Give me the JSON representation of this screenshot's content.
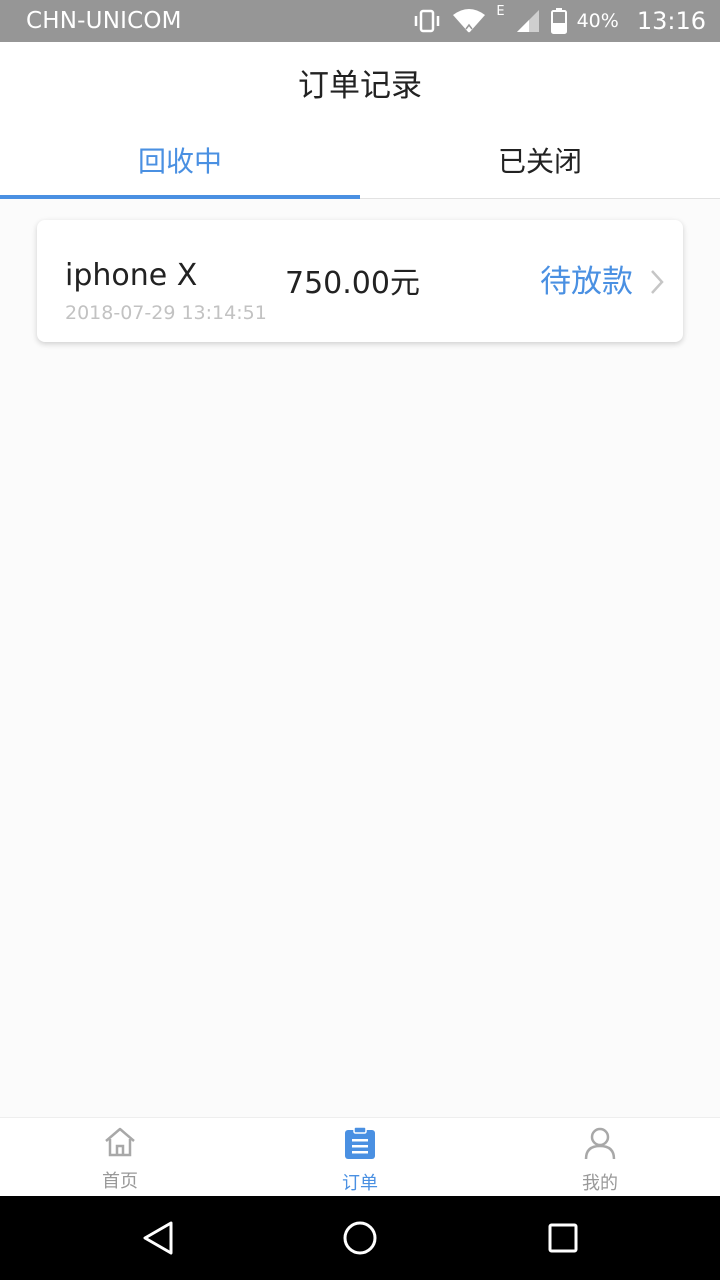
{
  "status_bar": {
    "carrier": "CHN-UNICOM",
    "network_type": "E",
    "battery": "40%",
    "time": "13:16",
    "icons": [
      "vibrate-icon",
      "wifi-icon",
      "signal-icon",
      "battery-icon"
    ]
  },
  "header": {
    "title": "订单记录"
  },
  "tabs": [
    {
      "label": "回收中",
      "active": true
    },
    {
      "label": "已关闭",
      "active": false
    }
  ],
  "orders": [
    {
      "product": "iphone X",
      "price": "750.00元",
      "status": "待放款",
      "date": "2018-07-29 13:14:51"
    }
  ],
  "bottom_nav": [
    {
      "label": "首页",
      "icon": "home-icon",
      "active": false
    },
    {
      "label": "订单",
      "icon": "clipboard-icon",
      "active": true
    },
    {
      "label": "我的",
      "icon": "user-icon",
      "active": false
    }
  ],
  "colors": {
    "accent": "#4a90e2",
    "status_bar": "#969696",
    "text": "#222222",
    "muted": "#c2c2c2",
    "inactive": "#999999"
  }
}
